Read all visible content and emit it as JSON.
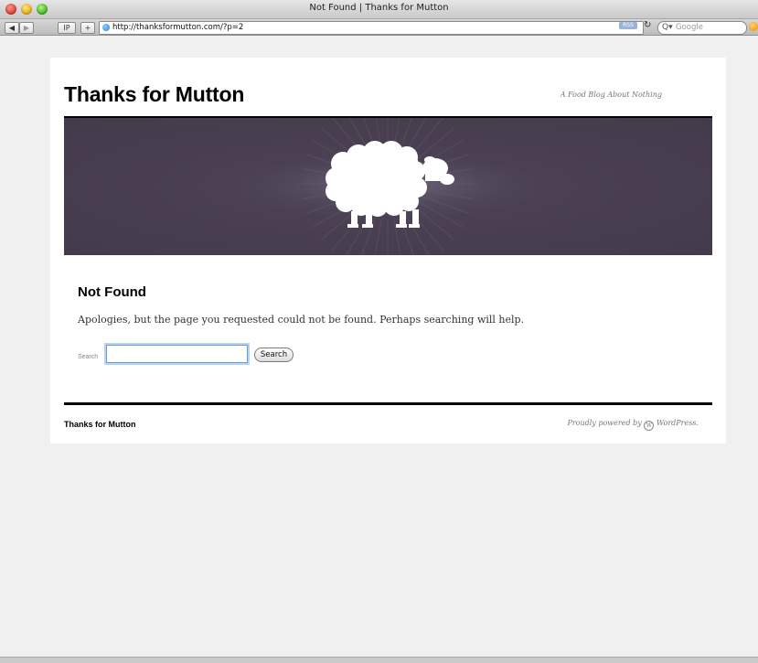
{
  "browser": {
    "window_title": "Not Found | Thanks for Mutton",
    "url": "http://thanksformutton.com/?p=2",
    "buttons": {
      "ip": "IP",
      "add": "+"
    },
    "rss_label": "RSS",
    "search_placeholder": "Google"
  },
  "site": {
    "title": "Thanks for Mutton",
    "tagline": "A Food Blog About Nothing"
  },
  "content": {
    "heading": "Not Found",
    "message": "Apologies, but the page you requested could not be found. Perhaps searching will help.",
    "search_label": "Search",
    "search_value": "",
    "search_button": "Search"
  },
  "footer": {
    "site_title": "Thanks for Mutton",
    "credit_prefix": "Proudly powered by",
    "credit_brand": "WordPress."
  },
  "colors": {
    "banner": "#433a4b",
    "sheep": "#ffffff",
    "focus": "#6a9ad6"
  }
}
